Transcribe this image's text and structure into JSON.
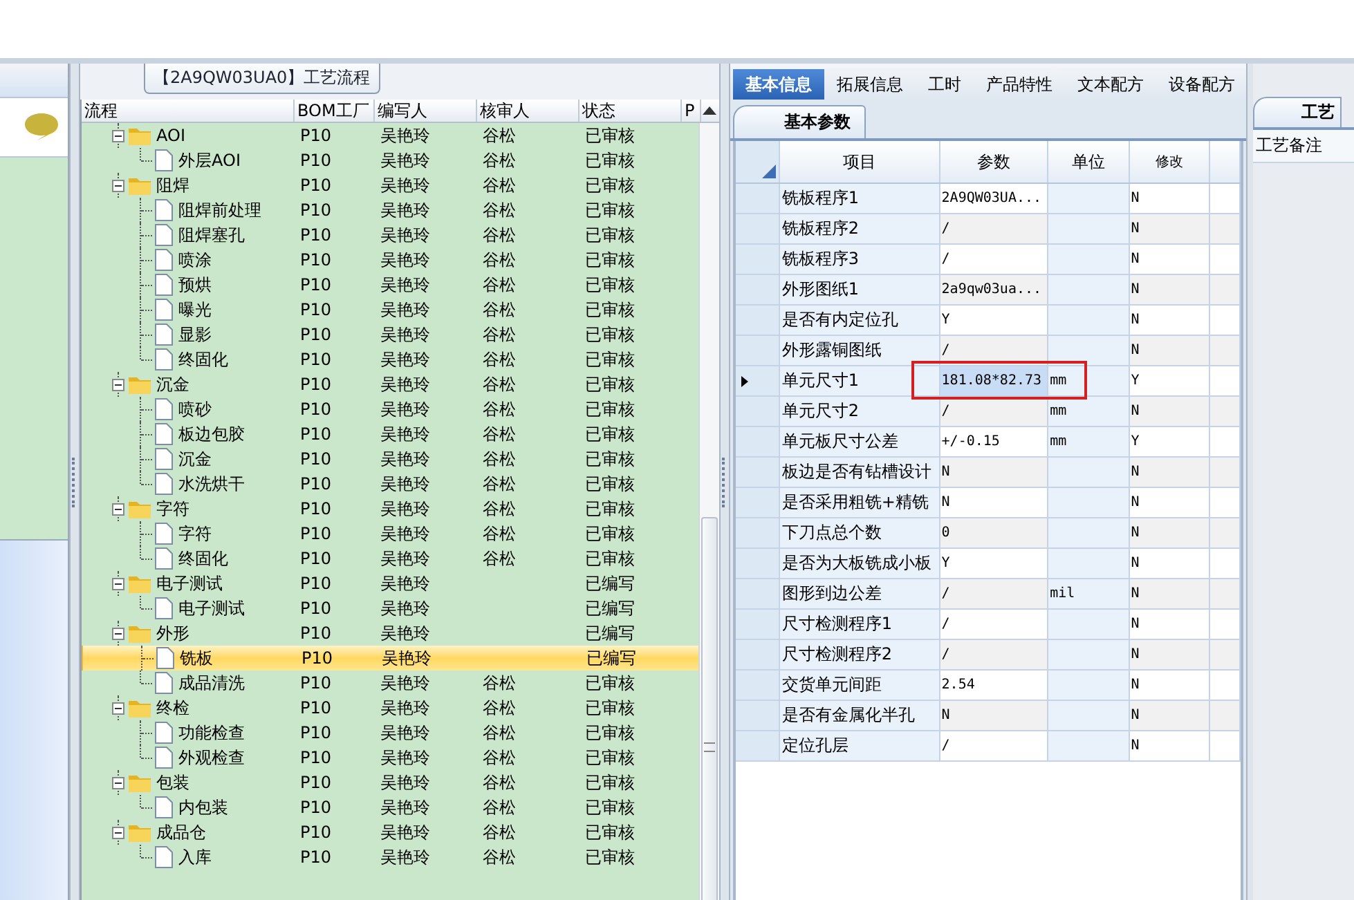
{
  "process_panel": {
    "title": "【2A9QW03UA0】工艺流程",
    "columns": [
      "流程",
      "BOM工厂",
      "编写人",
      "核审人",
      "状态",
      "P"
    ],
    "tree": [
      {
        "name": "AOI",
        "bom": "P10",
        "author": "吴艳玲",
        "reviewer": "谷松",
        "status": "已审核",
        "expanded": true,
        "selected": false,
        "children": [
          {
            "name": "外层AOI",
            "bom": "P10",
            "author": "吴艳玲",
            "reviewer": "谷松",
            "status": "已审核",
            "selected": false
          }
        ]
      },
      {
        "name": "阻焊",
        "bom": "P10",
        "author": "吴艳玲",
        "reviewer": "谷松",
        "status": "已审核",
        "expanded": true,
        "selected": false,
        "children": [
          {
            "name": "阻焊前处理",
            "bom": "P10",
            "author": "吴艳玲",
            "reviewer": "谷松",
            "status": "已审核",
            "selected": false
          },
          {
            "name": "阻焊塞孔",
            "bom": "P10",
            "author": "吴艳玲",
            "reviewer": "谷松",
            "status": "已审核",
            "selected": false
          },
          {
            "name": "喷涂",
            "bom": "P10",
            "author": "吴艳玲",
            "reviewer": "谷松",
            "status": "已审核",
            "selected": false
          },
          {
            "name": "预烘",
            "bom": "P10",
            "author": "吴艳玲",
            "reviewer": "谷松",
            "status": "已审核",
            "selected": false
          },
          {
            "name": "曝光",
            "bom": "P10",
            "author": "吴艳玲",
            "reviewer": "谷松",
            "status": "已审核",
            "selected": false
          },
          {
            "name": "显影",
            "bom": "P10",
            "author": "吴艳玲",
            "reviewer": "谷松",
            "status": "已审核",
            "selected": false
          },
          {
            "name": "终固化",
            "bom": "P10",
            "author": "吴艳玲",
            "reviewer": "谷松",
            "status": "已审核",
            "selected": false
          }
        ]
      },
      {
        "name": "沉金",
        "bom": "P10",
        "author": "吴艳玲",
        "reviewer": "谷松",
        "status": "已审核",
        "expanded": true,
        "selected": false,
        "children": [
          {
            "name": "喷砂",
            "bom": "P10",
            "author": "吴艳玲",
            "reviewer": "谷松",
            "status": "已审核",
            "selected": false
          },
          {
            "name": "板边包胶",
            "bom": "P10",
            "author": "吴艳玲",
            "reviewer": "谷松",
            "status": "已审核",
            "selected": false
          },
          {
            "name": "沉金",
            "bom": "P10",
            "author": "吴艳玲",
            "reviewer": "谷松",
            "status": "已审核",
            "selected": false
          },
          {
            "name": "水洗烘干",
            "bom": "P10",
            "author": "吴艳玲",
            "reviewer": "谷松",
            "status": "已审核",
            "selected": false
          }
        ]
      },
      {
        "name": "字符",
        "bom": "P10",
        "author": "吴艳玲",
        "reviewer": "谷松",
        "status": "已审核",
        "expanded": true,
        "selected": false,
        "children": [
          {
            "name": "字符",
            "bom": "P10",
            "author": "吴艳玲",
            "reviewer": "谷松",
            "status": "已审核",
            "selected": false
          },
          {
            "name": "终固化",
            "bom": "P10",
            "author": "吴艳玲",
            "reviewer": "谷松",
            "status": "已审核",
            "selected": false
          }
        ]
      },
      {
        "name": "电子测试",
        "bom": "P10",
        "author": "吴艳玲",
        "status": "已编写",
        "expanded": true,
        "selected": false,
        "children": [
          {
            "name": "电子测试",
            "bom": "P10",
            "author": "吴艳玲",
            "status": "已编写",
            "selected": false
          }
        ]
      },
      {
        "name": "外形",
        "bom": "P10",
        "author": "吴艳玲",
        "status": "已编写",
        "expanded": true,
        "selected": false,
        "children": [
          {
            "name": "铣板",
            "bom": "P10",
            "author": "吴艳玲",
            "status": "已编写",
            "selected": true
          },
          {
            "name": "成品清洗",
            "bom": "P10",
            "author": "吴艳玲",
            "reviewer": "谷松",
            "status": "已审核",
            "selected": false
          }
        ]
      },
      {
        "name": "终检",
        "bom": "P10",
        "author": "吴艳玲",
        "reviewer": "谷松",
        "status": "已审核",
        "expanded": true,
        "selected": false,
        "children": [
          {
            "name": "功能检查",
            "bom": "P10",
            "author": "吴艳玲",
            "reviewer": "谷松",
            "status": "已审核",
            "selected": false
          },
          {
            "name": "外观检查",
            "bom": "P10",
            "author": "吴艳玲",
            "reviewer": "谷松",
            "status": "已审核",
            "selected": false
          }
        ]
      },
      {
        "name": "包装",
        "bom": "P10",
        "author": "吴艳玲",
        "reviewer": "谷松",
        "status": "已审核",
        "expanded": true,
        "selected": false,
        "children": [
          {
            "name": "内包装",
            "bom": "P10",
            "author": "吴艳玲",
            "reviewer": "谷松",
            "status": "已审核",
            "selected": false
          }
        ]
      },
      {
        "name": "成品仓",
        "bom": "P10",
        "author": "吴艳玲",
        "reviewer": "谷松",
        "status": "已审核",
        "expanded": true,
        "selected": false,
        "children": [
          {
            "name": "入库",
            "bom": "P10",
            "author": "吴艳玲",
            "reviewer": "谷松",
            "status": "已审核",
            "selected": false
          }
        ]
      }
    ]
  },
  "info_panel": {
    "tabs": [
      {
        "label": "基本信息",
        "selected": true
      },
      {
        "label": "拓展信息",
        "selected": false
      },
      {
        "label": "工时",
        "selected": false
      },
      {
        "label": "产品特性",
        "selected": false
      },
      {
        "label": "文本配方",
        "selected": false
      },
      {
        "label": "设备配方",
        "selected": false
      }
    ],
    "section_tab": "基本参数",
    "columns": [
      "项目",
      "参数",
      "单位",
      "修改"
    ],
    "rows": [
      {
        "item": "铣板程序1",
        "param": "2A9QW03UA...",
        "modified": "N",
        "current": false,
        "outlined": false
      },
      {
        "item": "铣板程序2",
        "param": "/",
        "modified": "N",
        "current": false,
        "outlined": false
      },
      {
        "item": "铣板程序3",
        "param": "/",
        "modified": "N",
        "current": false,
        "outlined": false
      },
      {
        "item": "外形图纸1",
        "param": "2a9qw03ua...",
        "modified": "N",
        "current": false,
        "outlined": false
      },
      {
        "item": "是否有内定位孔",
        "param": "Y",
        "modified": "N",
        "current": false,
        "outlined": false
      },
      {
        "item": "外形露铜图纸",
        "param": "/",
        "modified": "N",
        "current": false,
        "outlined": false
      },
      {
        "item": "单元尺寸1",
        "param": "181.08*82.73",
        "unit": "mm",
        "modified": "Y",
        "current": true,
        "outlined": true
      },
      {
        "item": "单元尺寸2",
        "param": "/",
        "unit": "mm",
        "modified": "N",
        "current": false,
        "outlined": false
      },
      {
        "item": "单元板尺寸公差",
        "param": "+/-0.15",
        "unit": "mm",
        "modified": "Y",
        "current": false,
        "outlined": false
      },
      {
        "item": "板边是否有钻槽设计",
        "param": "N",
        "modified": "N",
        "current": false,
        "outlined": false
      },
      {
        "item": "是否采用粗铣+精铣",
        "param": "N",
        "modified": "N",
        "current": false,
        "outlined": false
      },
      {
        "item": "下刀点总个数",
        "param": "0",
        "modified": "N",
        "current": false,
        "outlined": false
      },
      {
        "item": "是否为大板铣成小板",
        "param": "Y",
        "modified": "N",
        "current": false,
        "outlined": false
      },
      {
        "item": "图形到边公差",
        "param": "/",
        "unit": "mil",
        "modified": "N",
        "current": false,
        "outlined": false
      },
      {
        "item": "尺寸检测程序1",
        "param": "/",
        "modified": "N",
        "current": false,
        "outlined": false
      },
      {
        "item": "尺寸检测程序2",
        "param": "/",
        "modified": "N",
        "current": false,
        "outlined": false
      },
      {
        "item": "交货单元间距",
        "param": "2.54",
        "modified": "N",
        "current": false,
        "outlined": false
      },
      {
        "item": "是否有金属化半孔",
        "param": "N",
        "modified": "N",
        "current": false,
        "outlined": false
      },
      {
        "item": "定位孔层",
        "param": "/",
        "modified": "N",
        "current": false,
        "outlined": false
      }
    ]
  },
  "notes_panel": {
    "tab": "工艺",
    "label": "工艺备注"
  }
}
